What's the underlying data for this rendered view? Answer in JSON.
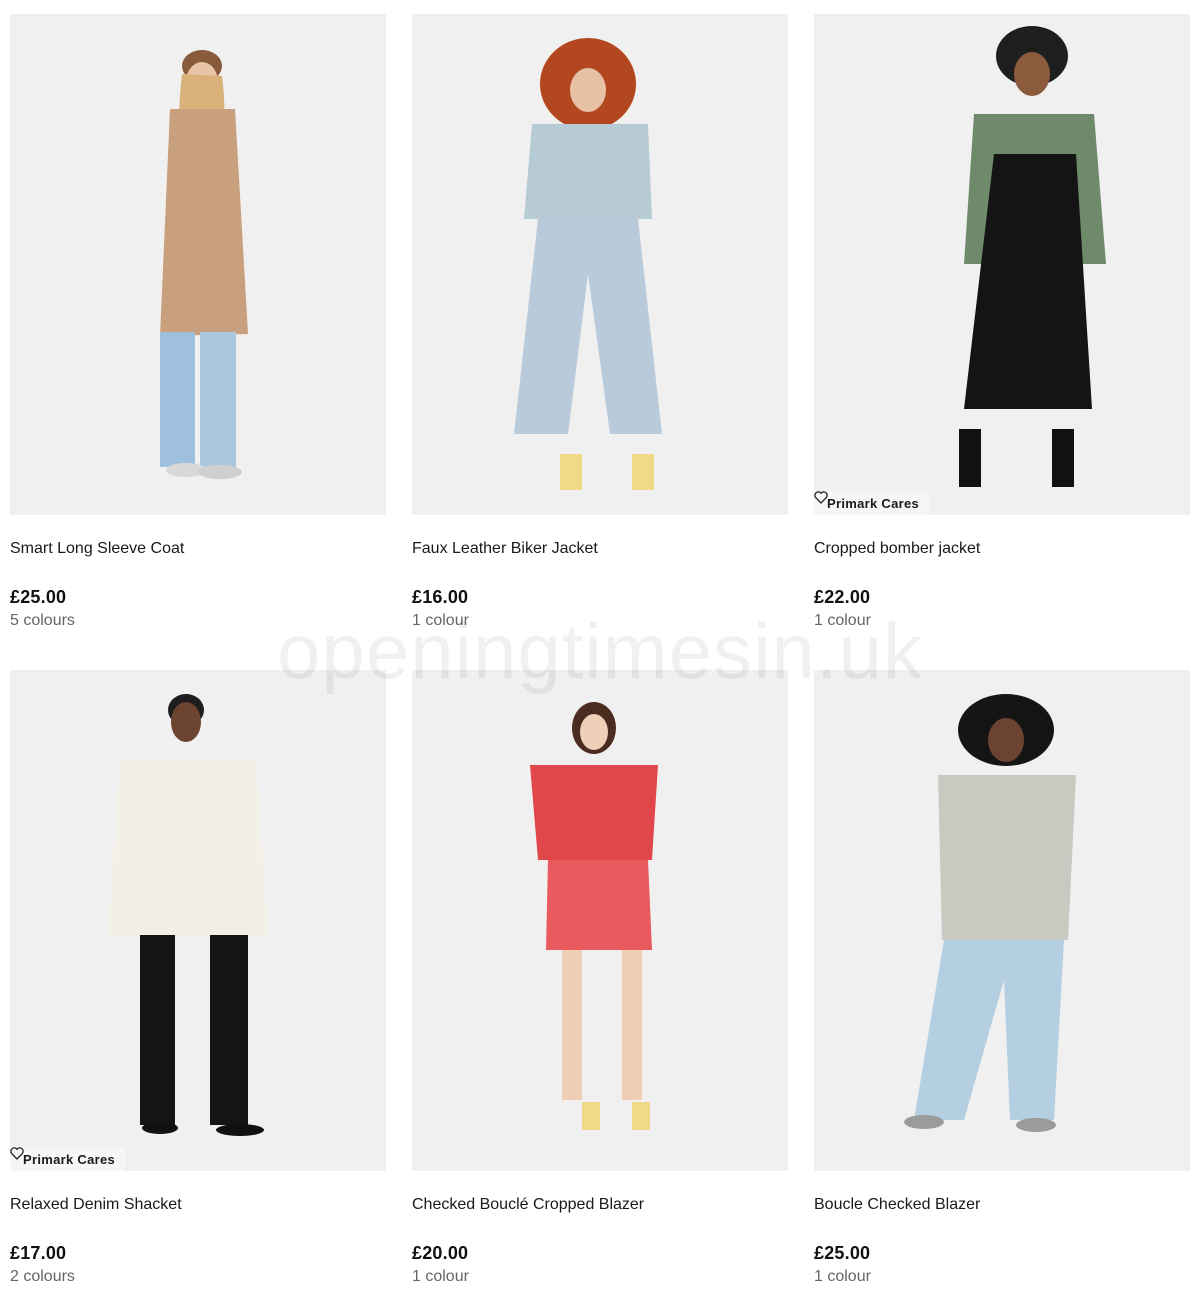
{
  "watermark": "openingtimesin.uk",
  "products": [
    {
      "name": "Smart Long Sleeve Coat",
      "price": "£25.00",
      "colours": "5 colours",
      "badge": ""
    },
    {
      "name": "Faux Leather Biker Jacket",
      "price": "£16.00",
      "colours": "1 colour",
      "badge": ""
    },
    {
      "name": "Cropped bomber jacket",
      "price": "£22.00",
      "colours": "1 colour",
      "badge": "Primark Cares"
    },
    {
      "name": "Relaxed Denim Shacket",
      "price": "£17.00",
      "colours": "2 colours",
      "badge": "Primark Cares"
    },
    {
      "name": "Checked Bouclé Cropped Blazer",
      "price": "£20.00",
      "colours": "1 colour",
      "badge": ""
    },
    {
      "name": "Boucle Checked Blazer",
      "price": "£25.00",
      "colours": "1 colour",
      "badge": ""
    }
  ],
  "colors": {
    "photo_bg": "#f0f0f0",
    "price": "#111111",
    "muted": "#666666"
  }
}
